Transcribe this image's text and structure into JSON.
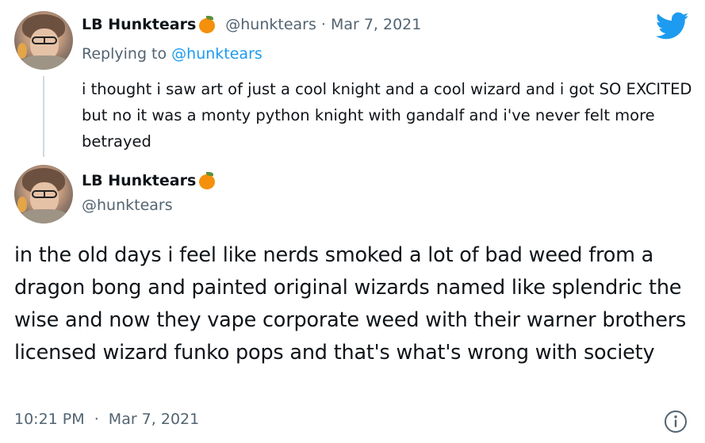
{
  "tweet1": {
    "display_name": "LB Hunktears",
    "badge_icon": "orange-icon",
    "handle": "@hunktears",
    "separator": "·",
    "date": "Mar 7, 2021",
    "replying_prefix": "Replying to ",
    "replying_to": "@hunktears",
    "text": "i thought i saw art of just a cool knight and a cool wizard and i got SO EXCITED but no it was a monty python knight with gandalf and i've never felt more betrayed"
  },
  "tweet2": {
    "display_name": "LB Hunktears",
    "badge_icon": "orange-icon",
    "handle": "@hunktears",
    "text": "in the old days i feel like nerds smoked a lot of bad weed from a dragon bong and painted original wizards named like splendric the wise and now they vape corporate weed with their warner brothers licensed wizard funko pops and that's what's wrong with society",
    "time": "10:21 PM",
    "separator": "·",
    "date": "Mar 7, 2021"
  },
  "icons": {
    "brand": "twitter-bird-icon",
    "info": "info-icon"
  },
  "colors": {
    "brand_blue": "#1d9bf0",
    "muted_text": "#536471",
    "primary_text": "#0f1419",
    "thread_line": "#cfd9de",
    "orange": "#f4900c"
  }
}
